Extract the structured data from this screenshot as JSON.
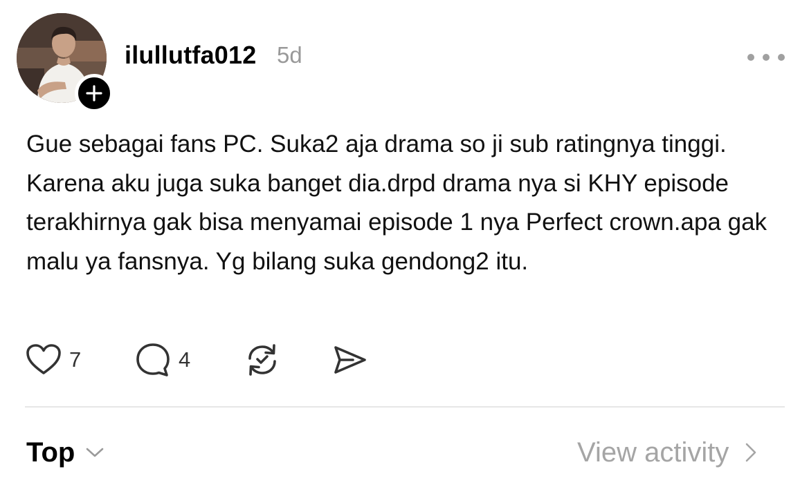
{
  "post": {
    "author": {
      "username": "ilullutfa012",
      "avatar_icon": "profile-photo",
      "follow_icon": "plus-icon"
    },
    "timestamp": "5d",
    "more_icon": "more-horizontal-icon",
    "body": "Gue sebagai fans PC. Suka2 aja drama so ji sub ratingnya tinggi. Karena aku juga suka banget dia.drpd drama nya si KHY episode terakhirnya gak bisa menyamai episode 1 nya Perfect crown.apa gak malu ya fansnya. Yg bilang suka gendong2 itu.",
    "actions": {
      "like": {
        "icon": "heart-icon",
        "count": "7"
      },
      "reply": {
        "icon": "comment-bubble-icon",
        "count": "4"
      },
      "repost": {
        "icon": "repost-icon"
      },
      "share": {
        "icon": "send-icon"
      }
    }
  },
  "footer": {
    "sort_label": "Top",
    "sort_icon": "chevron-down-icon",
    "view_activity_label": "View activity",
    "view_activity_icon": "chevron-right-icon"
  },
  "colors": {
    "text": "#111111",
    "muted": "#999999",
    "divider": "#e6e6e6",
    "icon": "#333333"
  }
}
